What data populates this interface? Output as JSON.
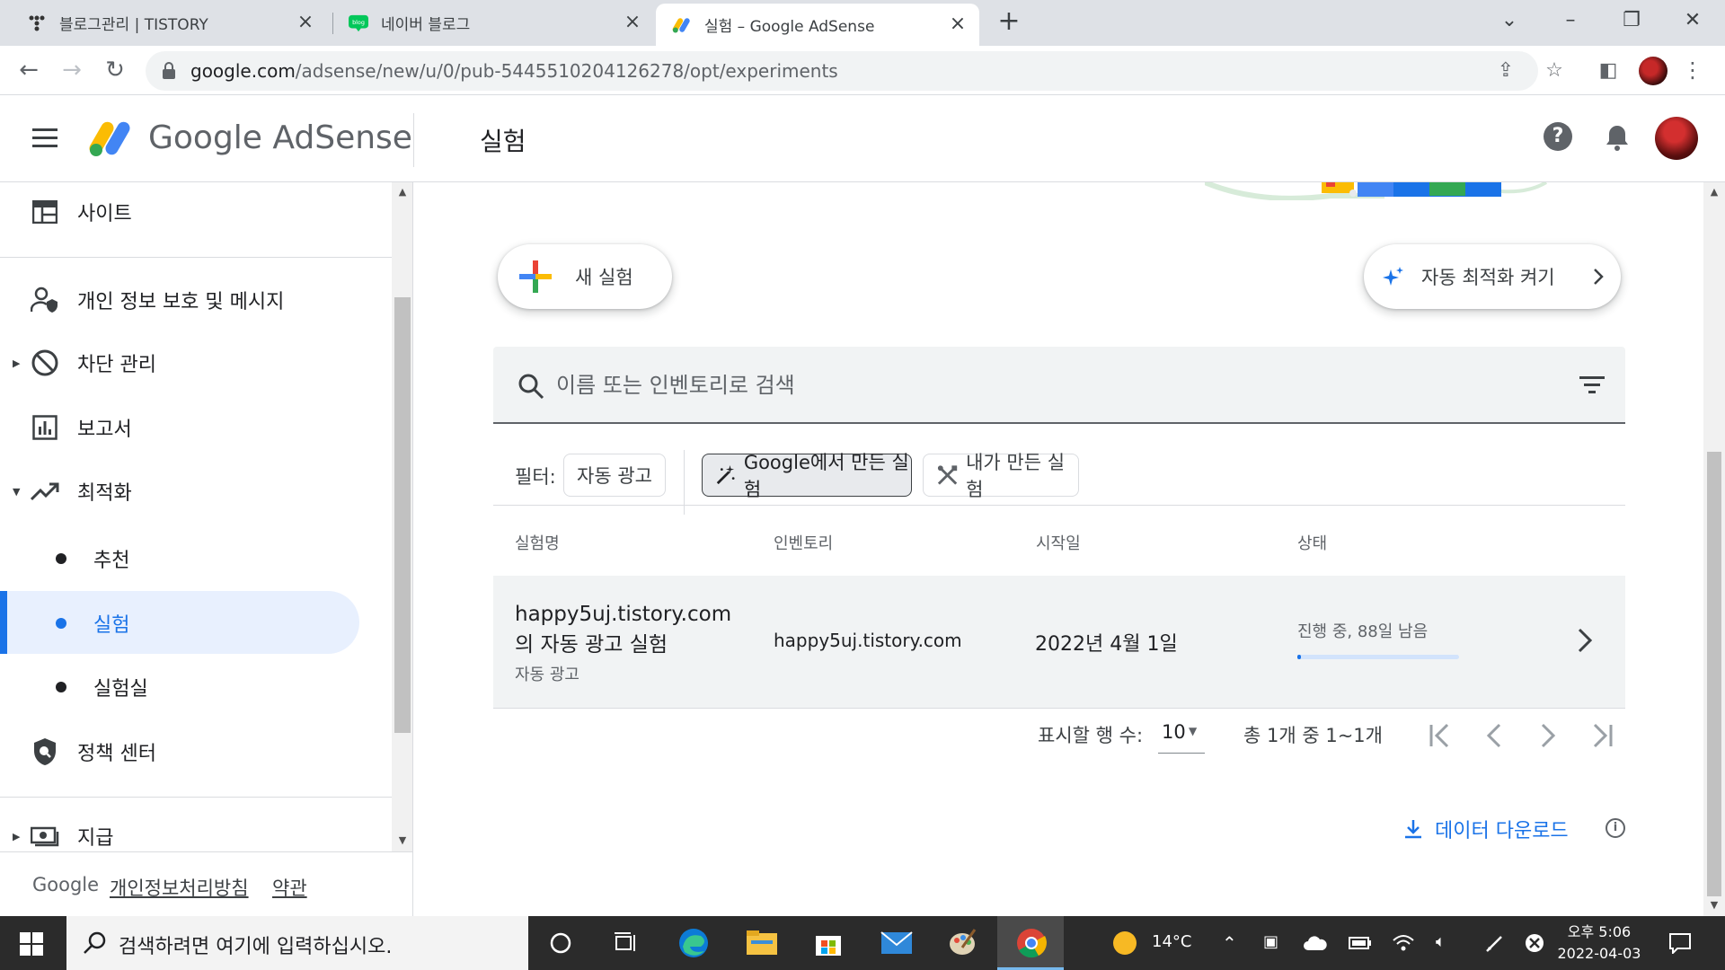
{
  "browser": {
    "tabs": [
      {
        "title": "블로그관리 | TISTORY",
        "active": false
      },
      {
        "title": "네이버 블로그",
        "active": false
      },
      {
        "title": "실험 – Google AdSense",
        "active": true
      }
    ],
    "url_host": "google.com",
    "url_path": "/adsense/new/u/0/pub-5445510204126278/opt/experiments"
  },
  "header": {
    "brand": "Google AdSense",
    "page_title": "실험"
  },
  "sidebar": {
    "items": [
      {
        "label": "사이트",
        "icon": "web-layout-icon"
      },
      {
        "label": "개인 정보 보호 및 메시지",
        "icon": "person-shield-icon"
      },
      {
        "label": "차단 관리",
        "icon": "block-icon"
      },
      {
        "label": "보고서",
        "icon": "bar-chart-icon"
      },
      {
        "label": "최적화",
        "icon": "trending-up-icon"
      }
    ],
    "sub_items": [
      {
        "label": "추천"
      },
      {
        "label": "실험",
        "active": true
      },
      {
        "label": "실험실"
      }
    ],
    "items_after": [
      {
        "label": "정책 센터",
        "icon": "policy-shield-icon"
      },
      {
        "label": "지급",
        "icon": "payments-icon"
      }
    ],
    "footer": {
      "google": "Google",
      "privacy": "개인정보처리방침",
      "terms": "약관"
    }
  },
  "main": {
    "new_experiment": "새 실험",
    "auto_optimize": "자동 최적화 켜기",
    "search_placeholder": "이름 또는 인벤토리로 검색",
    "filter_label": "필터:",
    "chips": [
      "자동 광고",
      "Google에서 만든 실험",
      "내가 만든 실험"
    ],
    "table": {
      "headers": [
        "실험명",
        "인벤토리",
        "시작일",
        "상태"
      ],
      "rows": [
        {
          "name": "happy5uj.tistory.com의 자동 광고 실험",
          "type": "자동 광고",
          "inventory": "happy5uj.tistory.com",
          "start_date": "2022년 4월 1일",
          "status": "진행 중, 88일 남음",
          "progress": 0.02
        }
      ]
    },
    "pagination": {
      "rows_label": "표시할 행 수:",
      "rows_value": "10",
      "range": "총 1개 중 1~1개"
    },
    "download": "데이터 다운로드"
  },
  "taskbar": {
    "search_placeholder": "검색하려면 여기에 입력하십시오.",
    "temperature": "14°C",
    "time": "오후 5:06",
    "date": "2022-04-03"
  },
  "colors": {
    "accent": "#1a73e8",
    "active_nav_bg": "#e8f0fe",
    "taskbar": "#2b2b2b"
  }
}
